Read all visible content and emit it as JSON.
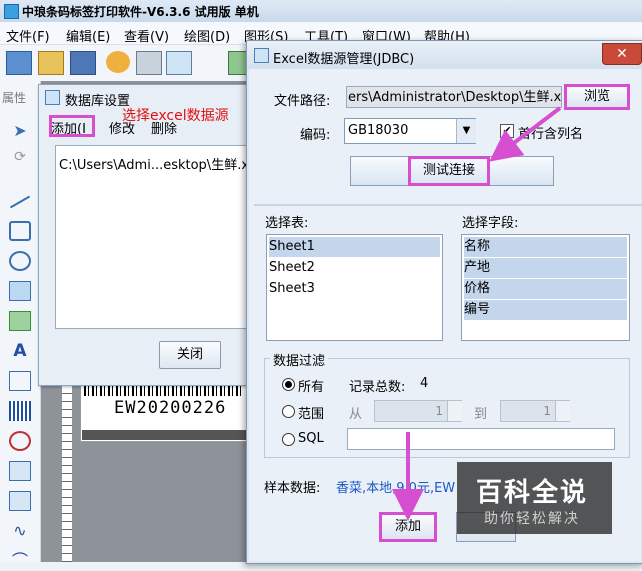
{
  "app": {
    "title": "中琅条码标签打印软件-V6.3.6 试用版 单机",
    "menu": [
      "文件(F)",
      "编辑(E)",
      "查看(V)",
      "绘图(D)",
      "图形(S)",
      "工具(T)",
      "窗口(W)",
      "帮助(H)"
    ],
    "side_tab": "属性"
  },
  "canvas": {
    "barcode_text": "EW20200226"
  },
  "db_window": {
    "title": "数据库设置",
    "add_label": "添加(I",
    "edit_label": "修改",
    "delete_label": "删除",
    "item": "C:\\Users\\Admi...esktop\\生鲜.x",
    "close_label": "关闭",
    "callout": "选择excel数据源"
  },
  "excel_dialog": {
    "title": "Excel数据源管理(JDBC)",
    "close_symbol": "✕",
    "file_path_label": "文件路径:",
    "file_path_value": "ers\\Administrator\\Desktop\\生鲜.xls",
    "browse_label": "浏览",
    "encoding_label": "编码:",
    "encoding_value": "GB18030",
    "first_row_label": "首行含列名",
    "first_row_checked": true,
    "test_label": "测试连接",
    "tables_label": "选择表:",
    "tables": [
      "Sheet1",
      "Sheet2",
      "Sheet3"
    ],
    "fields_label": "选择字段:",
    "fields": [
      "名称",
      "产地",
      "价格",
      "编号"
    ],
    "filter_title": "数据过滤",
    "filter_all": "所有",
    "record_count_label": "记录总数:",
    "record_count": "4",
    "filter_range": "范围",
    "range_from_label": "从",
    "range_from": "1",
    "range_to_label": "到",
    "range_to": "1",
    "filter_sql": "SQL",
    "sample_label": "样本数据:",
    "sample_value": "香菜,本地,9.0元,EW",
    "add_label": "添加"
  },
  "watermark": {
    "title": "百科全说",
    "subtitle": "助你轻松解决"
  },
  "colors": {
    "highlight": "#d64fd0",
    "arrow": "#d64fd0",
    "callout": "#e01010",
    "link": "#1c58c8"
  }
}
